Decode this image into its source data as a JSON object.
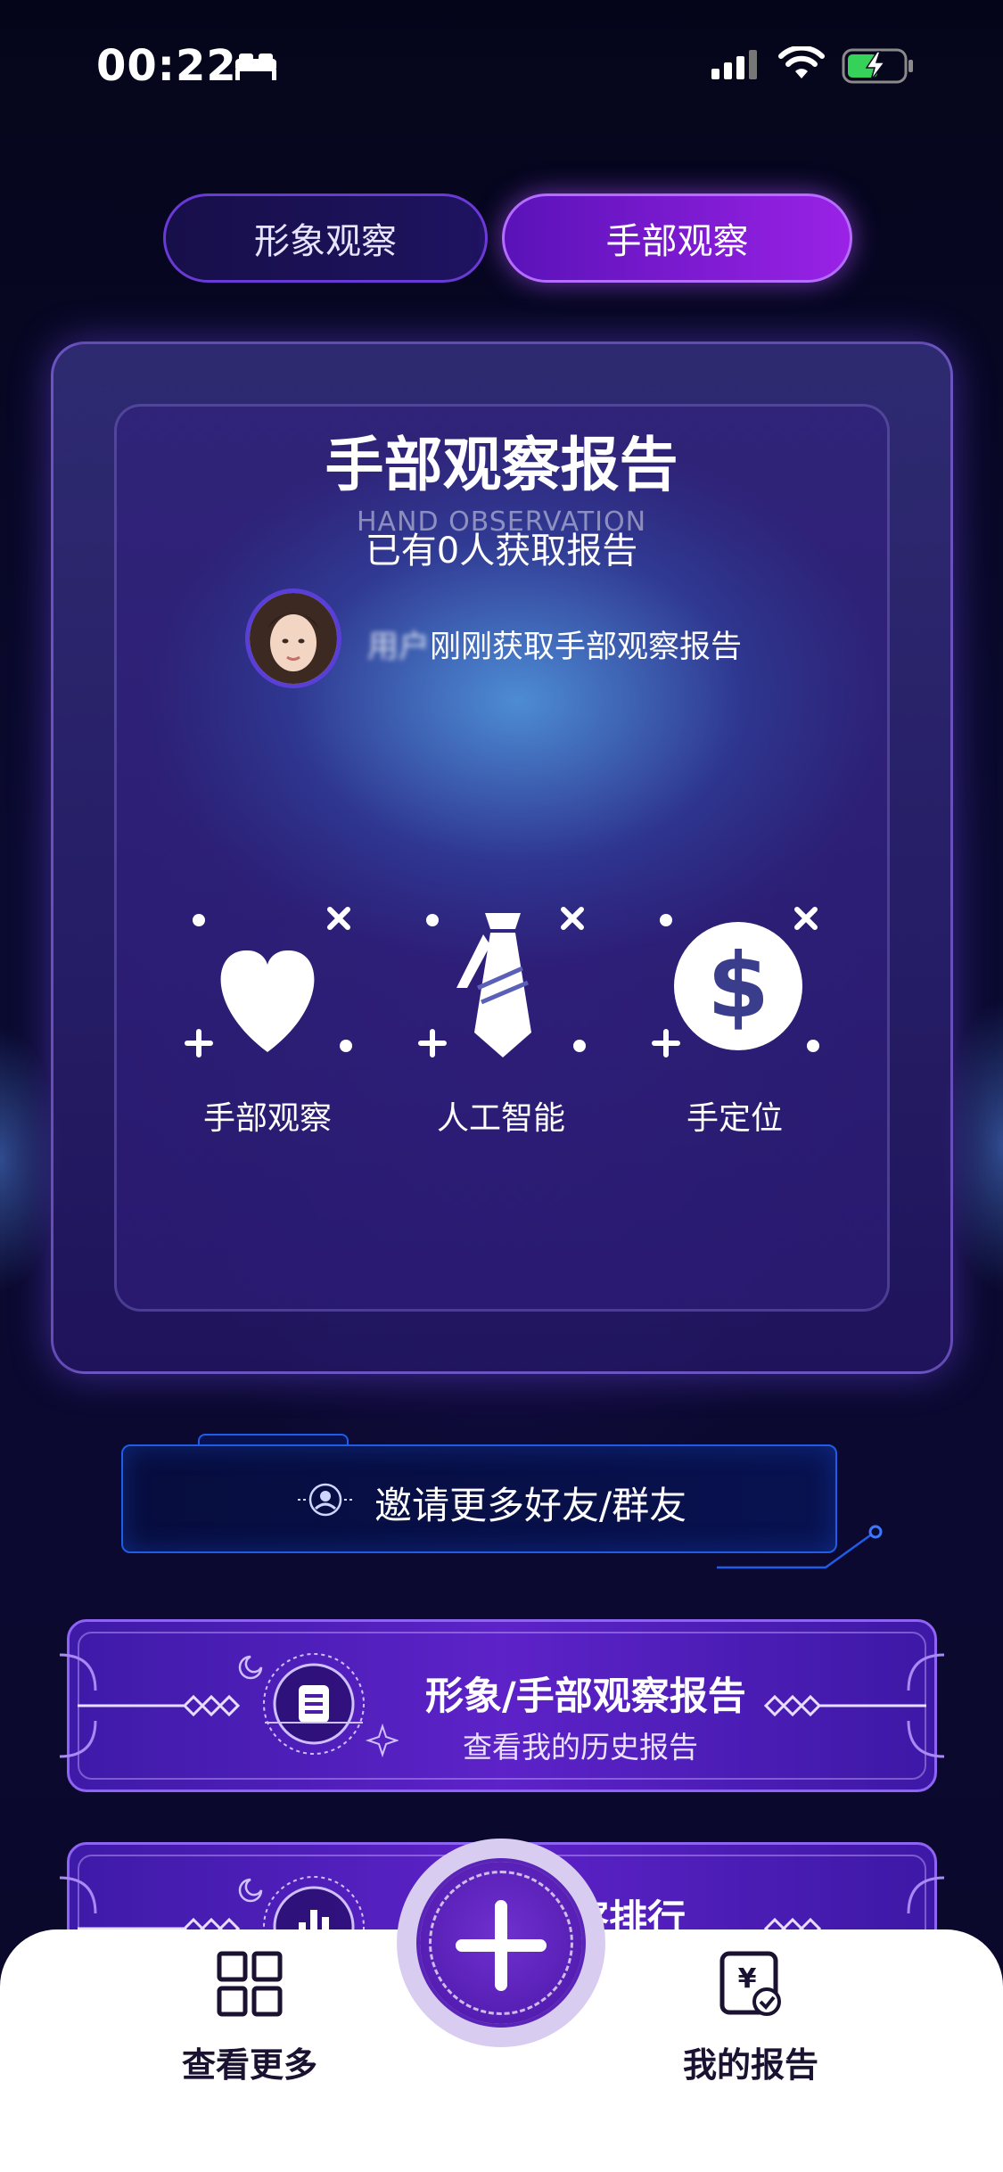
{
  "status_bar": {
    "time": "00:22"
  },
  "tabs": [
    {
      "label": "形象观察",
      "active": false
    },
    {
      "label": "手部观察",
      "active": true
    }
  ],
  "report_card": {
    "title": "手部观察报告",
    "subtitle_en": "HAND OBSERVATION",
    "count_text": "已有0人获取报告",
    "notice_user": "用户",
    "notice_text": "刚刚获取手部观察报告",
    "features": [
      {
        "icon": "heart-icon",
        "label": "手部观察"
      },
      {
        "icon": "tie-icon",
        "label": "人工智能"
      },
      {
        "icon": "dollar-icon",
        "label": "手定位"
      }
    ]
  },
  "invite": {
    "label": "邀请更多好友/群友"
  },
  "banners": [
    {
      "title": "形象/手部观察报告",
      "subtitle": "查看我的历史报告",
      "icon": "document-icon"
    },
    {
      "title": "观察排行",
      "subtitle": "",
      "icon": "chart-icon"
    }
  ],
  "bottom_nav": {
    "left_label": "查看更多",
    "right_label": "我的报告",
    "center_icon": "plus-icon"
  },
  "colors": {
    "active_tab": "#9a22e6",
    "background": "#060622",
    "banner": "#5d22c8",
    "invite_border": "#1f5ce8"
  }
}
